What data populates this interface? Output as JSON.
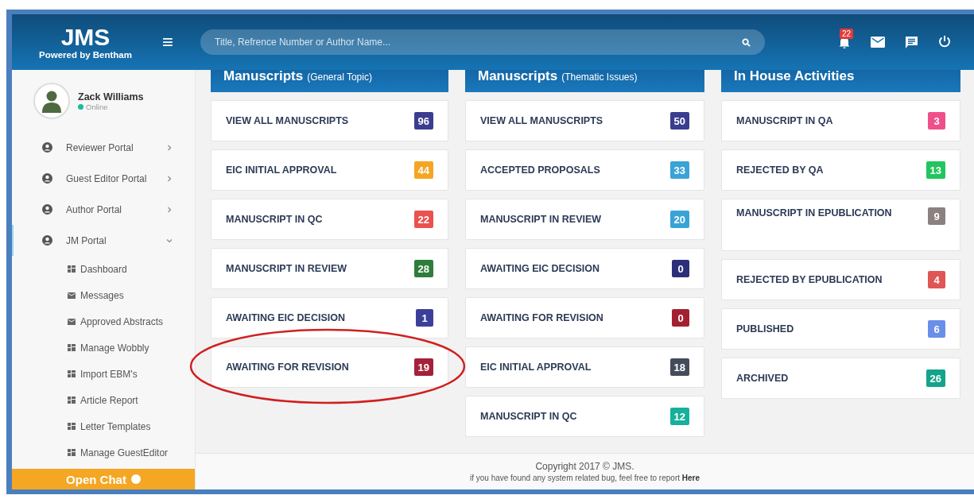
{
  "header": {
    "logo": "JMS",
    "tagline": "Powered by Bentham",
    "menu_icon": "≡",
    "search": {
      "placeholder": "Title, Refrence Number or Author Name..."
    },
    "notification_count": "22"
  },
  "sidebar": {
    "user": {
      "name": "Zack Williams",
      "status": "Online",
      "online": true
    },
    "items": [
      {
        "label": "Reviewer Portal",
        "selected": false,
        "expanded": false
      },
      {
        "label": "Guest Editor Portal",
        "selected": false,
        "expanded": false
      },
      {
        "label": "Author Portal",
        "selected": false,
        "expanded": false
      },
      {
        "label": "JM Portal",
        "selected": true,
        "expanded": true,
        "children": [
          {
            "label": "Dashboard",
            "kind": "grid"
          },
          {
            "label": "Messages",
            "kind": "mail"
          },
          {
            "label": "Approved Abstracts",
            "kind": "mail"
          },
          {
            "label": "Manage Wobbly",
            "kind": "grid"
          },
          {
            "label": "Import EBM's",
            "kind": "grid"
          },
          {
            "label": "Article Report",
            "kind": "grid"
          },
          {
            "label": "Letter Templates",
            "kind": "grid"
          },
          {
            "label": "Manage GuestEditor",
            "kind": "grid"
          }
        ]
      }
    ],
    "chat_button": "Open Chat"
  },
  "columns": [
    {
      "title": "Manuscripts",
      "subtitle": "(General Topic)",
      "cards": [
        {
          "label": "VIEW ALL MANUSCRIPTS",
          "count": "96",
          "color": "#3b3d8f",
          "highlighted": false
        },
        {
          "label": "EIC INITIAL APPROVAL",
          "count": "44",
          "color": "#f4a623",
          "highlighted": false
        },
        {
          "label": "MANUSCRIPT IN QC",
          "count": "22",
          "color": "#e9524f",
          "highlighted": false
        },
        {
          "label": "MANUSCRIPT IN REVIEW",
          "count": "28",
          "color": "#2e7d3b",
          "highlighted": false
        },
        {
          "label": "AWAITING EIC DECISION",
          "count": "1",
          "color": "#3c3f9a",
          "highlighted": false
        },
        {
          "label": "AWAITING FOR REVISION",
          "count": "19",
          "color": "#a3213a",
          "highlighted": true
        }
      ]
    },
    {
      "title": "Manuscripts",
      "subtitle": "(Thematic Issues)",
      "cards": [
        {
          "label": "VIEW ALL MANUSCRIPTS",
          "count": "50",
          "color": "#3b3d8f",
          "highlighted": false
        },
        {
          "label": "ACCEPTED PROPOSALS",
          "count": "33",
          "color": "#3aa3d6",
          "highlighted": false
        },
        {
          "label": "MANUSCRIPT IN REVIEW",
          "count": "20",
          "color": "#3aa3d6",
          "highlighted": false
        },
        {
          "label": "AWAITING EIC DECISION",
          "count": "0",
          "color": "#2c2f7a",
          "highlighted": false
        },
        {
          "label": "AWAITING FOR REVISION",
          "count": "0",
          "color": "#a32030",
          "highlighted": false
        },
        {
          "label": "EIC INITIAL APPROVAL",
          "count": "18",
          "color": "#444c5c",
          "highlighted": false
        },
        {
          "label": "MANUSCRIPT IN QC",
          "count": "12",
          "color": "#17b09a",
          "highlighted": false
        }
      ]
    },
    {
      "title": "In House Activities",
      "cards": [
        {
          "label": "MANUSCRIPT IN QA",
          "count": "3",
          "color": "#f0508a",
          "highlighted": false
        },
        {
          "label": "REJECTED BY QA",
          "count": "13",
          "color": "#22c55e",
          "highlighted": false
        },
        {
          "label": "MANUSCRIPT IN EPUBLICATION",
          "count": "9",
          "color": "#8d8080",
          "highlighted": false
        },
        {
          "label": "REJECTED BY EPUBLICATION",
          "count": "4",
          "color": "#e05555",
          "highlighted": false
        },
        {
          "label": "PUBLISHED",
          "count": "6",
          "color": "#6a8fe8",
          "highlighted": false
        },
        {
          "label": "ARCHIVED",
          "count": "26",
          "color": "#14a38b",
          "highlighted": false
        }
      ]
    }
  ],
  "footer": {
    "copyright": "Copyright 2017 © JMS.",
    "report_text": "if you have found any system related bug, feel free to report",
    "report_link": "Here"
  }
}
